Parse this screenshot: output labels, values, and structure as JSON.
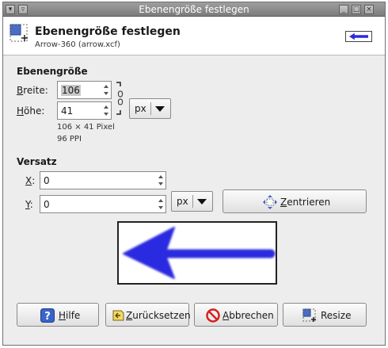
{
  "window": {
    "title": "Ebenengröße festlegen"
  },
  "header": {
    "title": "Ebenengröße festlegen",
    "subtitle": "Arrow-360 (arrow.xcf)"
  },
  "layer_size": {
    "section_title": "Ebenengröße",
    "width_label": "Breite:",
    "width_label_mnemonic": "B",
    "width_label_rest": "reite:",
    "width_value": "106",
    "height_label": "Höhe:",
    "height_label_mnemonic": "H",
    "height_label_rest": "öhe:",
    "height_value": "41",
    "unit": "px",
    "pixel_info": "106 × 41 Pixel",
    "ppi_info": "96 PPI"
  },
  "offset": {
    "section_title": "Versatz",
    "x_label_mnemonic": "X",
    "x_label_rest": ":",
    "x_value": "0",
    "y_label_mnemonic": "Y",
    "y_label_rest": ":",
    "y_value": "0",
    "unit": "px",
    "center_mnemonic": "Z",
    "center_rest": "entrieren"
  },
  "buttons": {
    "help_mnemonic": "H",
    "help_rest": "ilfe",
    "reset_mnemonic": "Z",
    "reset_rest": "urücksetzen",
    "cancel_mnemonic": "A",
    "cancel_rest": "bbrechen",
    "resize_label": "Resize"
  },
  "colors": {
    "arrow": "#2a2ae0",
    "help_icon": "#3a64c8",
    "cancel_icon": "#d42020"
  },
  "icons": {
    "header": "resize-layer-icon",
    "chain": "chain-link-icon",
    "center": "center-icon",
    "help": "help-icon",
    "reset": "reset-icon",
    "cancel": "cancel-icon",
    "resize": "resize-layer-icon"
  }
}
